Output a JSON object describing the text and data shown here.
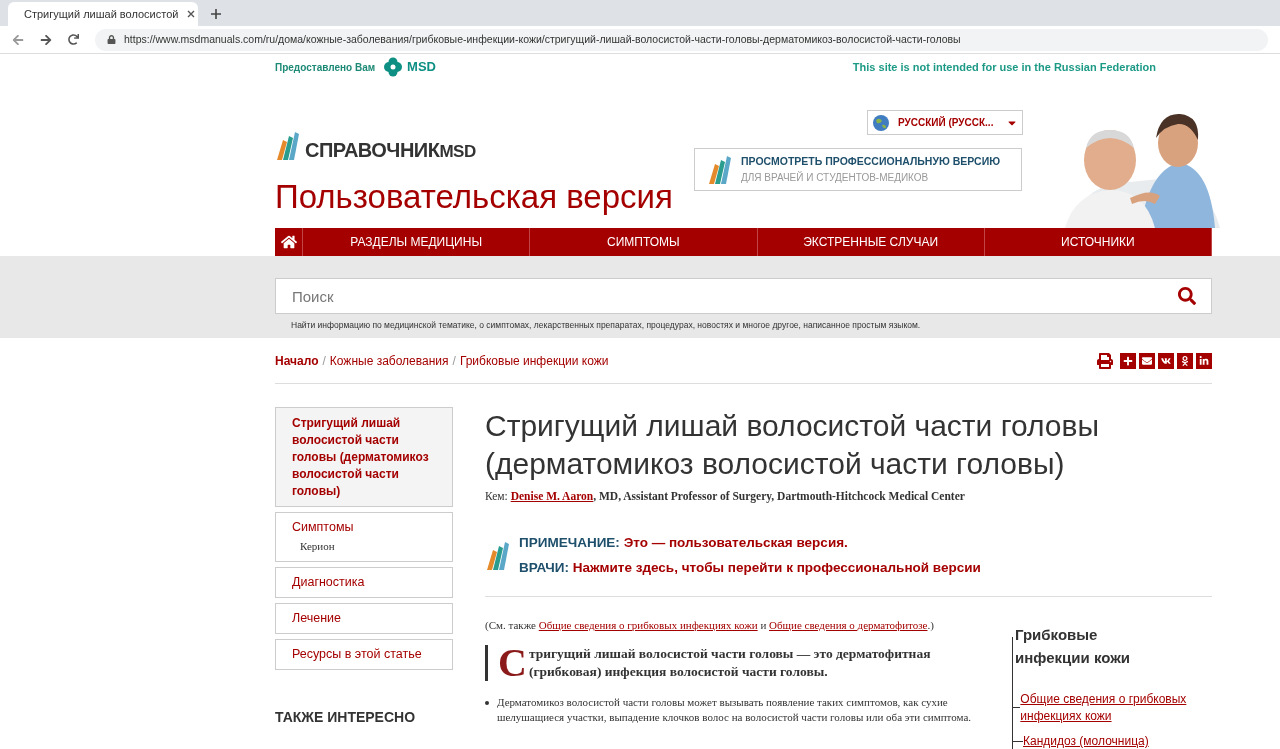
{
  "browser": {
    "tab_title": "Стригущий лишай волосистой",
    "url": "https://www.msdmanuals.com/ru/дома/кожные-заболевания/грибковые-инфекции-кожи/стригущий-лишай-волосистой-части-головы-дерматомикоз-волосистой-части-головы"
  },
  "top_strip": {
    "provided_by": "Предоставлено Вам",
    "sponsor": "MSD",
    "notice": "This site is not intended for use in the Russian Federation"
  },
  "header": {
    "logo_text": "СПРАВОЧНИК",
    "logo_suffix": "MSD",
    "version_title": "Пользовательская версия",
    "language": "РУССКИЙ (РУССК...",
    "pro_title": "ПРОСМОТРЕТЬ ПРОФЕССИОНАЛЬНУЮ ВЕРСИЮ",
    "pro_subtitle": "ДЛЯ ВРАЧЕЙ И СТУДЕНТОВ-МЕДИКОВ"
  },
  "nav": [
    "РАЗДЕЛЫ МЕДИЦИНЫ",
    "СИМПТОМЫ",
    "ЭКСТРЕННЫЕ СЛУЧАИ",
    "ИСТОЧНИКИ"
  ],
  "search": {
    "placeholder": "Поиск",
    "hint": "Найти информацию по медицинской тематике, о симптомах, лекарственных препаратах, процедурах, новостях и многое другое, написанное простым языком."
  },
  "breadcrumbs": {
    "separator": "/",
    "items": [
      "Начало",
      "Кожные заболевания",
      "Грибковые инфекции кожи"
    ]
  },
  "sidebar": {
    "items": [
      {
        "label": "Стригущий лишай волосистой части головы (дерматомикоз волосистой части головы)",
        "selected": true
      },
      {
        "label": "Симптомы",
        "selected": false,
        "children": [
          "Керион"
        ]
      },
      {
        "label": "Диагностика",
        "selected": false
      },
      {
        "label": "Лечение",
        "selected": false
      },
      {
        "label": "Ресурсы в этой статье",
        "selected": false
      }
    ],
    "also_title": "ТАКЖЕ ИНТЕРЕСНО"
  },
  "article": {
    "title": "Стригущий лишай волосистой части головы (дерматомикоз волосистой части головы)",
    "by_label": "Кем:",
    "author": "Denise M. Aaron",
    "author_rest": ", MD, Assistant Professor of Surgery, Dartmouth-Hitchcock Medical Center",
    "note_label": "ПРИМЕЧАНИЕ:",
    "note_text": "Это — пользовательская версия.",
    "doctors_label": "ВРАЧИ:",
    "doctors_text": "Нажмите здесь, чтобы перейти к профессиональной версии",
    "see_also_prefix": "(См. также",
    "see_also_link1": "Общие сведения о грибковых инфекциях кожи",
    "see_also_and": "и",
    "see_also_link2": "Общие сведения о дерматофитозе",
    "see_also_suffix": ".)",
    "drop_cap": "С",
    "lead": "тригущий лишай волосистой части головы — это дерматофитная (грибковая) инфекция волосистой части головы.",
    "bullets": [
      "Дерматомикоз волосистой части головы может вызывать появление таких симптомов, как сухие шелушащиеся участки, выпадение клочков волос на волосистой части головы или оба эти симптома."
    ]
  },
  "related": {
    "title": "Грибковые инфекции кожи",
    "links": [
      "Общие сведения о грибковых инфекциях кожи",
      "Кандидоз (молочница)"
    ]
  }
}
